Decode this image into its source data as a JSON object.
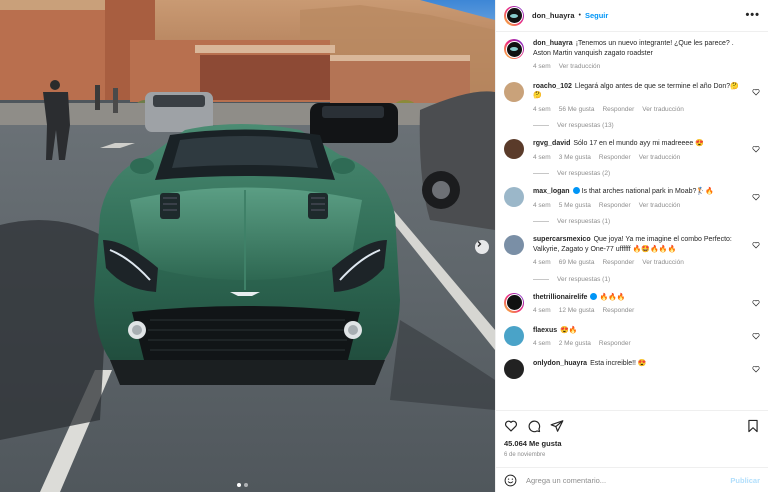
{
  "post": {
    "username": "don_huayra",
    "separator": "•",
    "follow_label": "Seguir",
    "more_label": "•••",
    "caption": {
      "username": "don_huayra",
      "text": "¡Tenemos un nuevo integrante! ¿Que les parece? . Aston Martin vanquish zagato roadster",
      "time": "4 sem",
      "translate": "Ver traducción"
    },
    "likes": "45.064 Me gusta",
    "date": "6 de noviembre"
  },
  "comments": [
    {
      "username": "roacho_102",
      "text": "Llegará algo antes de que se termine el año Don?🤔🤔",
      "time": "4 sem",
      "likes": "56 Me gusta",
      "reply": "Responder",
      "translate": "Ver traducción",
      "replies": "Ver respuestas (13)",
      "avatar_color": "#c9a27a"
    },
    {
      "username": "rgvg_david",
      "text": "Sólo 17 en el mundo ayy mi madreeee 😍",
      "time": "4 sem",
      "likes": "3 Me gusta",
      "reply": "Responder",
      "translate": "Ver traducción",
      "replies": "Ver respuestas (2)",
      "avatar_color": "#5a3b2a"
    },
    {
      "username": "max_logan",
      "text": "Is that arches national park in Moab?🏌️🔥",
      "time": "4 sem",
      "likes": "5 Me gusta",
      "reply": "Responder",
      "translate": "Ver traducción",
      "replies": "Ver respuestas (1)",
      "avatar_color": "#9bb7c9"
    },
    {
      "username": "supercarsmexico",
      "text": "Que joya! Ya me imagine el combo Perfecto: Valkyrie, Zagato y One-77 uffffff 🔥🤩🔥🔥🔥",
      "time": "4 sem",
      "likes": "69 Me gusta",
      "reply": "Responder",
      "translate": "Ver traducción",
      "replies": "Ver respuestas (1)",
      "avatar_color": "#7a8fa6"
    },
    {
      "username": "thetrillionairelife",
      "text": "🔥🔥🔥",
      "time": "4 sem",
      "likes": "12 Me gusta",
      "reply": "Responder",
      "avatar_color": "#111111"
    },
    {
      "username": "flaexus",
      "text": "😍🔥",
      "time": "4 sem",
      "likes": "2 Me gusta",
      "reply": "Responder",
      "avatar_color": "#4aa3c8"
    },
    {
      "username": "onlydon_huayra",
      "text": "Esta increible!! 😍",
      "time": "",
      "likes": "",
      "reply": "",
      "avatar_color": "#222222"
    }
  ],
  "comment_input": {
    "placeholder": "Agrega un comentario...",
    "publish_label": "Publicar"
  },
  "icons": {
    "like": "heart-icon",
    "comment": "comment-icon",
    "share": "share-icon",
    "save": "bookmark-icon",
    "emoji": "emoji-icon",
    "next": "chevron-right-icon"
  },
  "colors": {
    "accent": "#0095f6",
    "car_body": "#2f6b55",
    "publish_disabled": "#b2dffc"
  }
}
